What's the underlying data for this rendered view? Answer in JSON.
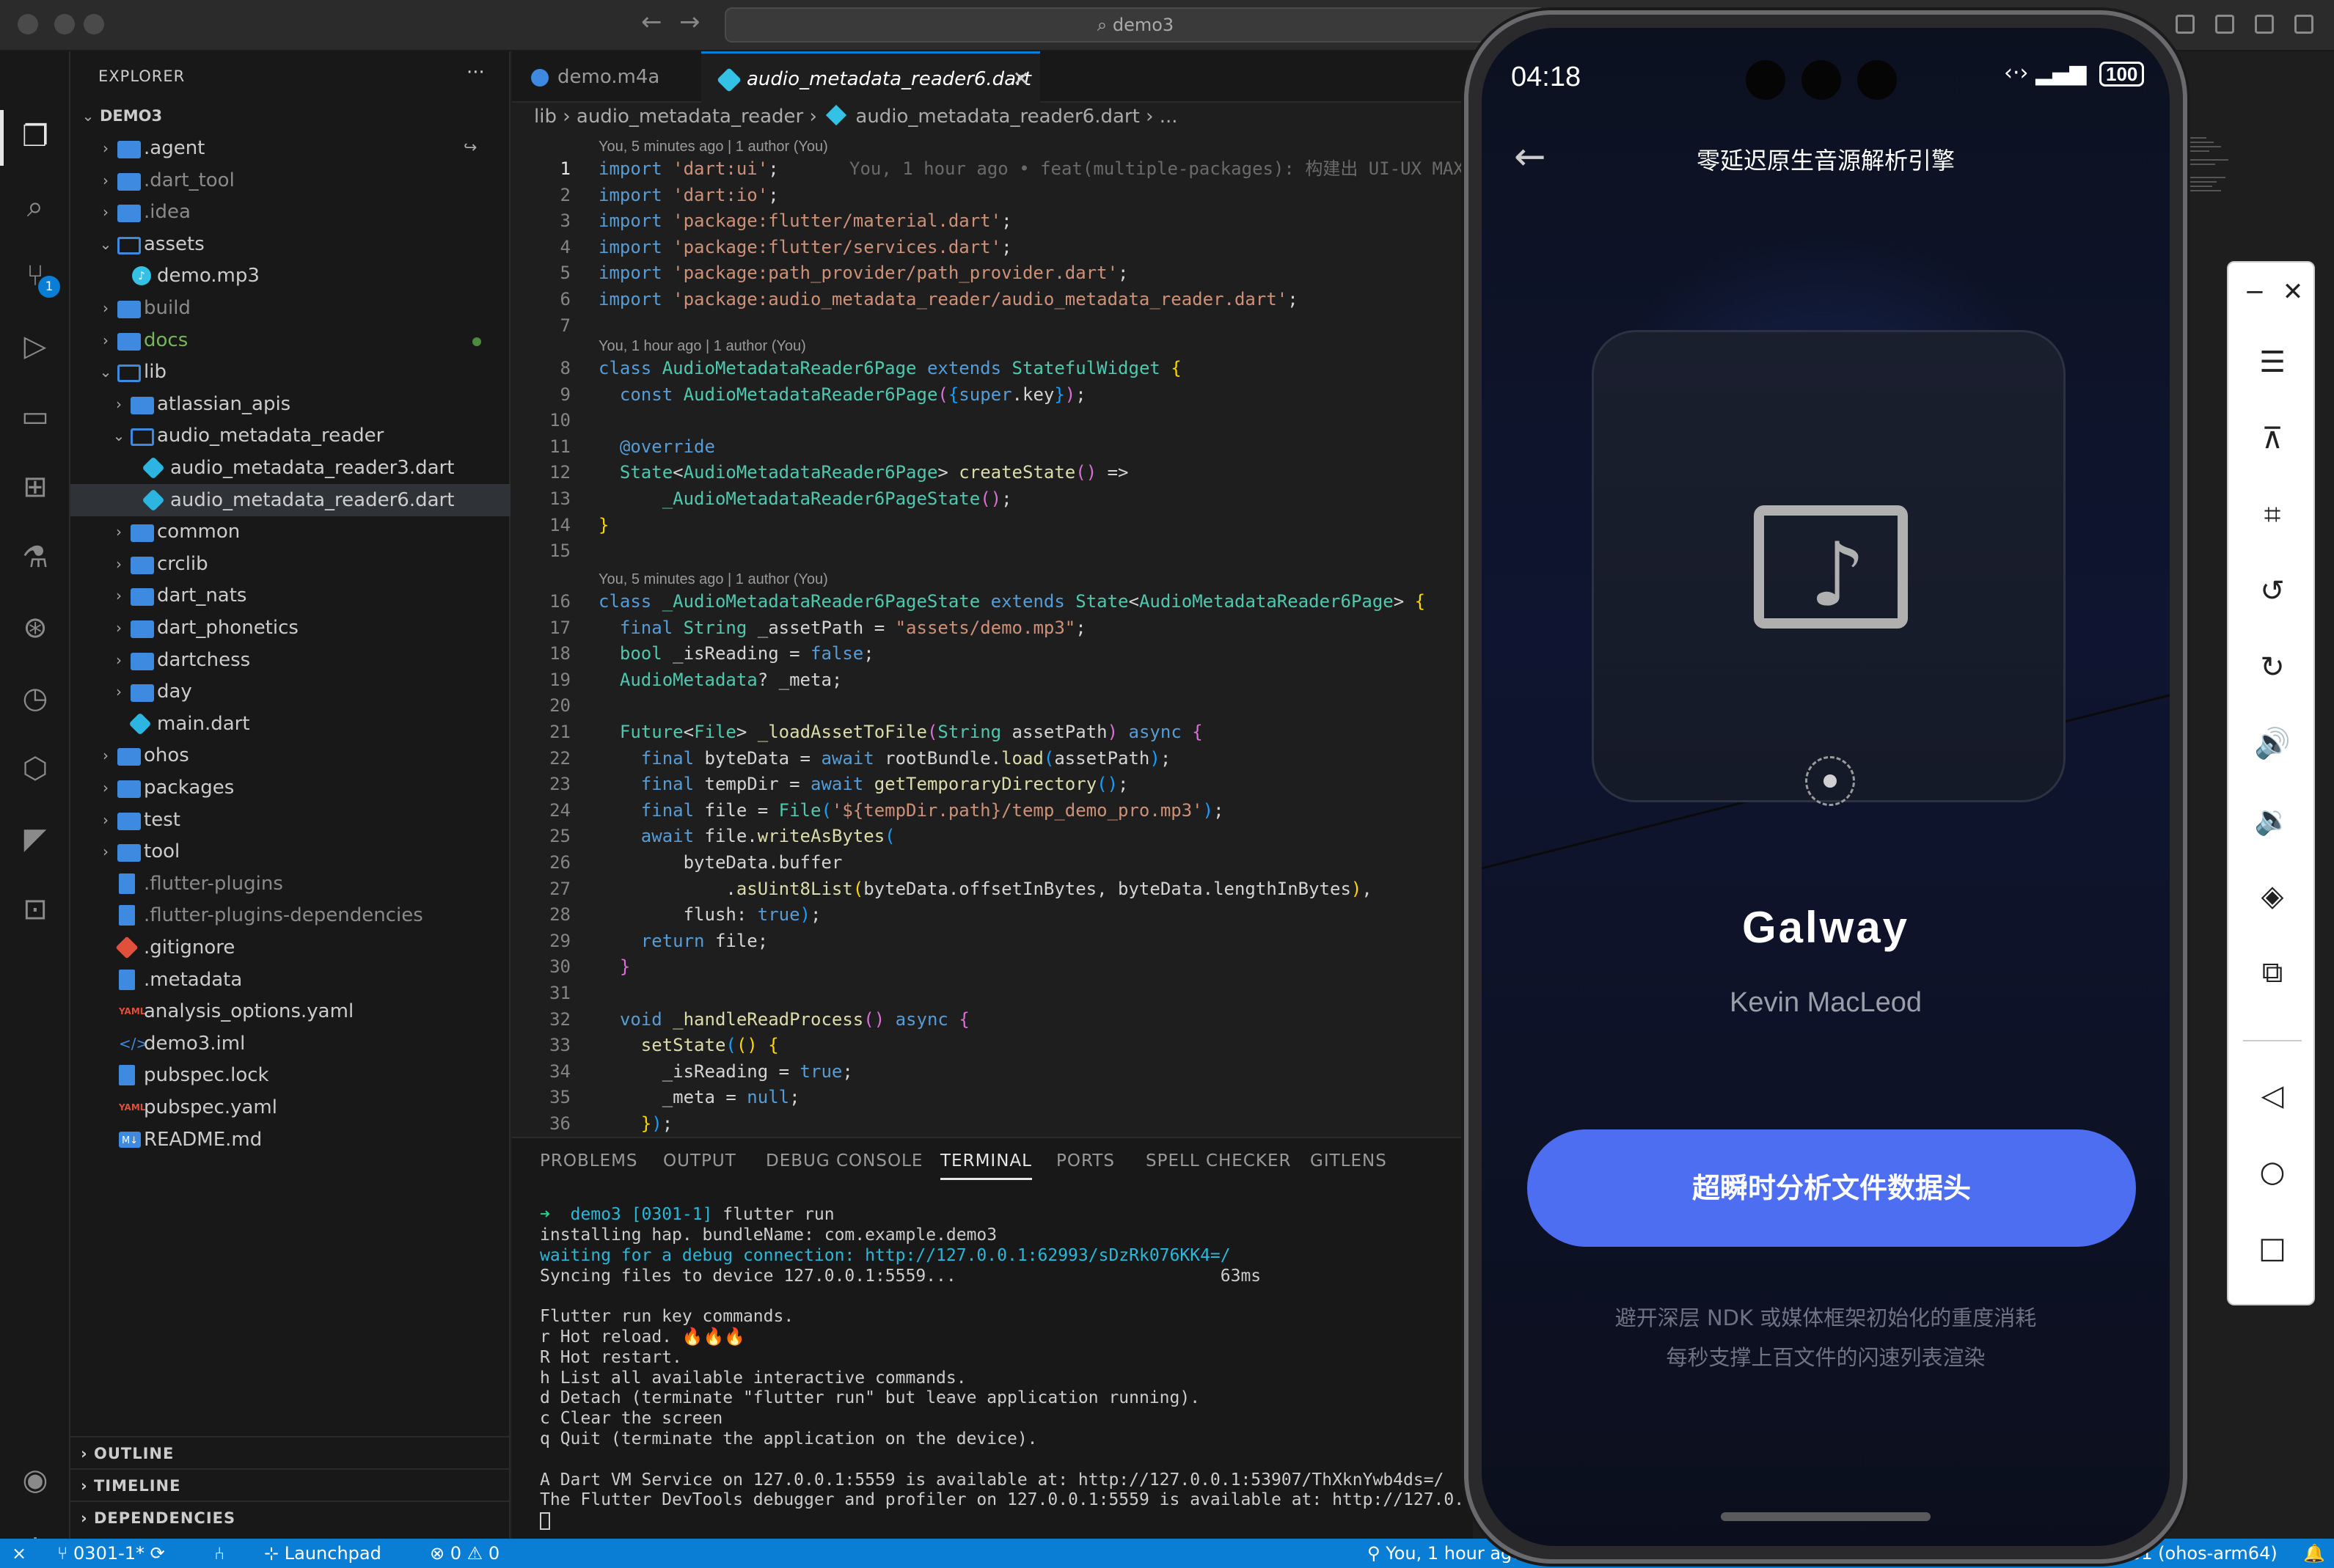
{
  "window": {
    "search": "demo3"
  },
  "sidebar": {
    "title": "EXPLORER",
    "more": "···",
    "root": "DEMO3",
    "items": [
      {
        "label": ".agent",
        "kind": "folder"
      },
      {
        "label": ".dart_tool",
        "kind": "folder"
      },
      {
        "label": ".idea",
        "kind": "folder"
      },
      {
        "label": "assets",
        "kind": "folder-open"
      },
      {
        "label": "demo.mp3",
        "kind": "file"
      },
      {
        "label": "build",
        "kind": "folder"
      },
      {
        "label": "docs",
        "kind": "folder"
      },
      {
        "label": "lib",
        "kind": "folder-open"
      },
      {
        "label": "atlassian_apis",
        "kind": "folder"
      },
      {
        "label": "audio_metadata_reader",
        "kind": "folder-open"
      },
      {
        "label": "audio_metadata_reader3.dart",
        "kind": "dart"
      },
      {
        "label": "audio_metadata_reader6.dart",
        "kind": "dart"
      },
      {
        "label": "common",
        "kind": "folder"
      },
      {
        "label": "crclib",
        "kind": "folder"
      },
      {
        "label": "dart_nats",
        "kind": "folder"
      },
      {
        "label": "dart_phonetics",
        "kind": "folder"
      },
      {
        "label": "dartchess",
        "kind": "folder"
      },
      {
        "label": "day",
        "kind": "folder"
      },
      {
        "label": "main.dart",
        "kind": "dart"
      },
      {
        "label": "ohos",
        "kind": "folder"
      },
      {
        "label": "packages",
        "kind": "folder"
      },
      {
        "label": "test",
        "kind": "folder"
      },
      {
        "label": "tool",
        "kind": "folder"
      },
      {
        "label": ".flutter-plugins",
        "kind": "doc"
      },
      {
        "label": ".flutter-plugins-dependencies",
        "kind": "doc"
      },
      {
        "label": ".gitignore",
        "kind": "git"
      },
      {
        "label": ".metadata",
        "kind": "doc"
      },
      {
        "label": "analysis_options.yaml",
        "kind": "yaml"
      },
      {
        "label": "demo3.iml",
        "kind": "code"
      },
      {
        "label": "pubspec.lock",
        "kind": "doc"
      },
      {
        "label": "pubspec.yaml",
        "kind": "yaml"
      },
      {
        "label": "README.md",
        "kind": "md"
      }
    ],
    "sections": [
      "OUTLINE",
      "TIMELINE",
      "DEPENDENCIES"
    ]
  },
  "activity": {
    "scm_badge": "1"
  },
  "editor": {
    "tabs": [
      {
        "label": "demo.m4a"
      },
      {
        "label": "audio_metadata_reader6.dart",
        "close": "✕"
      }
    ],
    "breadcrumb": [
      "lib",
      "audio_metadata_reader",
      "audio_metadata_reader6.dart",
      "..."
    ],
    "lens": [
      "You, 5 minutes ago | 1 author (You)",
      "You, 1 hour ago | 1 author (You)",
      "You, 5 minutes ago | 1 author (You)"
    ],
    "blame_inline": "You, 1 hour ago • feat(multiple-packages): 构建出 UI-UX MAX"
  },
  "panel": {
    "tabs": [
      "PROBLEMS",
      "OUTPUT",
      "DEBUG CONSOLE",
      "TERMINAL",
      "PORTS",
      "SPELL CHECKER",
      "GITLENS"
    ],
    "active_tab": "TERMINAL",
    "more": "···",
    "prompt": {
      "dir": "demo3",
      "branch": "[0301-1]",
      "cmd": "flutter run"
    },
    "lines": [
      "installing hap. bundleName: com.example.demo3",
      "waiting for a debug connection: http://127.0.0.1:62993/sDzRk076KK4=/",
      "Syncing files to device 127.0.0.1:5559...                          63ms",
      "",
      "Flutter run key commands.",
      "r Hot reload. 🔥🔥🔥",
      "R Hot restart.",
      "h List all available interactive commands.",
      "d Detach (terminate \"flutter run\" but leave application running).",
      "c Clear the screen",
      "q Quit (terminate the application on the device).",
      "",
      "A Dart VM Service on 127.0.0.1:5559 is available at: http://127.0.0.1:53907/ThXknYwb4ds=/",
      "The Flutter DevTools debugger and profiler on 127.0.0.1:5559 is available at: http://127.0."
    ]
  },
  "statusbar": {
    "branch": "0301-1*",
    "launchpad": "Launchpad",
    "errors": "0",
    "warnings": "0",
    "blame": "You, 1 hour ago",
    "device": "01 (ohos-arm64)"
  },
  "phone": {
    "time": "04:18",
    "battery": "100",
    "title": "零延迟原生音源解析引擎",
    "track": "Galway",
    "artist": "Kevin MacLeod",
    "button": "超瞬时分析文件数据头",
    "desc1": "避开深层 NDK 或媒体框架初始化的重度消耗",
    "desc2": "每秒支撑上百文件的闪速列表渲染"
  },
  "colors": {
    "accent": "#0a7dd4",
    "phone_button": "#4e6ef2",
    "phone_bg": "#0f1530"
  }
}
